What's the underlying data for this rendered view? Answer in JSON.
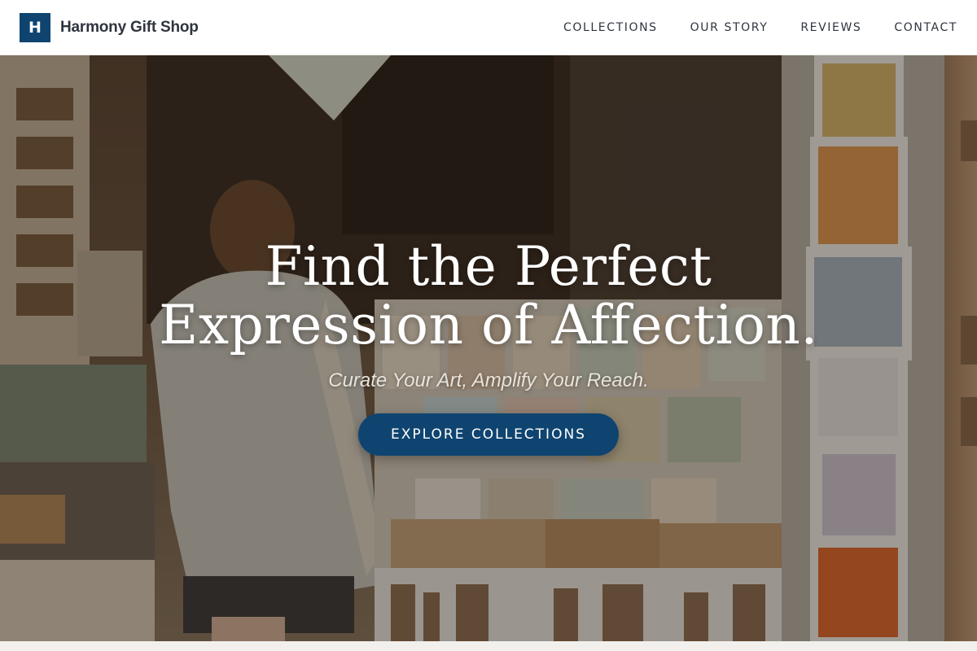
{
  "brand": {
    "logo_letter": "H",
    "name": "Harmony Gift Shop"
  },
  "nav": [
    {
      "label": "COLLECTIONS"
    },
    {
      "label": "OUR STORY"
    },
    {
      "label": "REVIEWS"
    },
    {
      "label": "CONTACT"
    }
  ],
  "hero": {
    "headline_line1": "Find the Perfect",
    "headline_line2": "Expression of Affection.",
    "tagline": "Curate Your Art, Amplify Your Reach.",
    "cta_label": "EXPLORE COLLECTIONS"
  },
  "colors": {
    "primary": "#0f4470",
    "header_bg": "#ffffff",
    "text_dark": "#2f3440"
  }
}
